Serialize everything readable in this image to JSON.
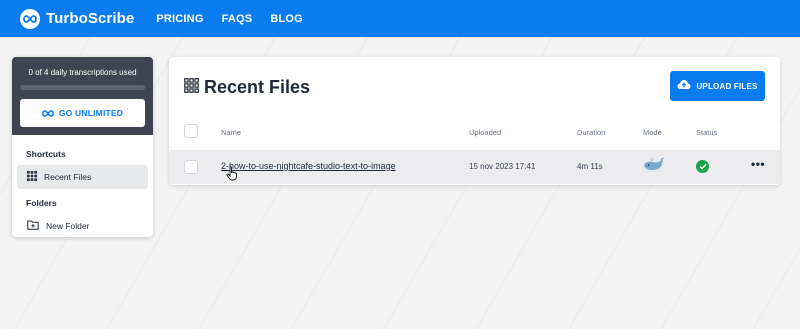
{
  "navbar": {
    "brand": "TurboScribe",
    "links": [
      "PRICING",
      "FAQS",
      "BLOG"
    ]
  },
  "sidebar": {
    "usage_text": "0 of 4 daily transcriptions used",
    "usage_fraction": 0,
    "go_unlimited_label": "GO UNLIMITED",
    "shortcuts_title": "Shortcuts",
    "recent_files_label": "Recent Files",
    "folders_title": "Folders",
    "new_folder_label": "New Folder"
  },
  "main": {
    "title": "Recent Files",
    "upload_label": "UPLOAD FILES",
    "columns": {
      "name": "Name",
      "uploaded": "Uploaded",
      "duration": "Duration",
      "mode": "Mode",
      "status": "Status"
    },
    "rows": [
      {
        "name": "2-how-to-use-nightcafe-studio-text-to-image",
        "uploaded": "15 nov 2023 17:41",
        "duration": "4m 11s",
        "mode_icon": "whale-icon",
        "status_icon": "check-circle-icon",
        "more_label": "•••"
      }
    ]
  },
  "colors": {
    "brand_blue": "#0a7cf0",
    "usage_box": "#3e4451",
    "status_green": "#16a34a"
  }
}
